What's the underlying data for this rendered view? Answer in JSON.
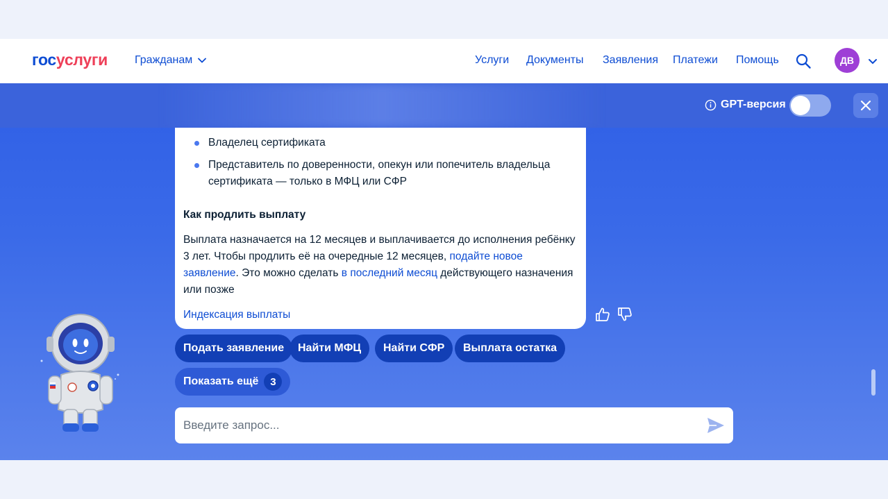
{
  "header": {
    "logo_part1": "гос",
    "logo_part2": "услуги",
    "audience": "Гражданам",
    "nav": [
      "Услуги",
      "Документы",
      "Заявления",
      "Платежи",
      "Помощь"
    ],
    "avatar_initials": "ДВ"
  },
  "chat_bar": {
    "gpt_label": "GPT-версия",
    "gpt_toggle_on": false
  },
  "message": {
    "bullets": [
      "Владелец сертификата",
      "Представитель по доверенности, опекун или попечитель владельца сертификата — только в МФЦ или СФР"
    ],
    "heading": "Как продлить выплату",
    "para_1": "Выплата назначается на 12 месяцев и выплачивается до исполнения ребёнку 3 лет. Чтобы продлить её на очередные 12 месяцев, ",
    "link_new_application": "подайте новое заявление",
    "para_2": ". Это можно сделать ",
    "link_last_month": "в последний месяц",
    "para_3": " действующего назначения или позже",
    "link_indexation": "Индексация выплаты"
  },
  "chips": [
    "Подать заявление",
    "Найти МФЦ",
    "Найти СФР",
    "Выплата остатка"
  ],
  "more_chip": {
    "label": "Показать ещё",
    "count": "3"
  },
  "input": {
    "placeholder": "Введите запрос..."
  },
  "colors": {
    "brand_blue": "#0d4cd3",
    "brand_red": "#ee3f58",
    "chip_blue": "#123fb5",
    "avatar_purple": "#9e3fd6"
  },
  "icons": [
    "search-icon",
    "chevron-down-icon",
    "info-icon",
    "close-icon",
    "thumbs-up-icon",
    "thumbs-down-icon",
    "send-icon"
  ]
}
